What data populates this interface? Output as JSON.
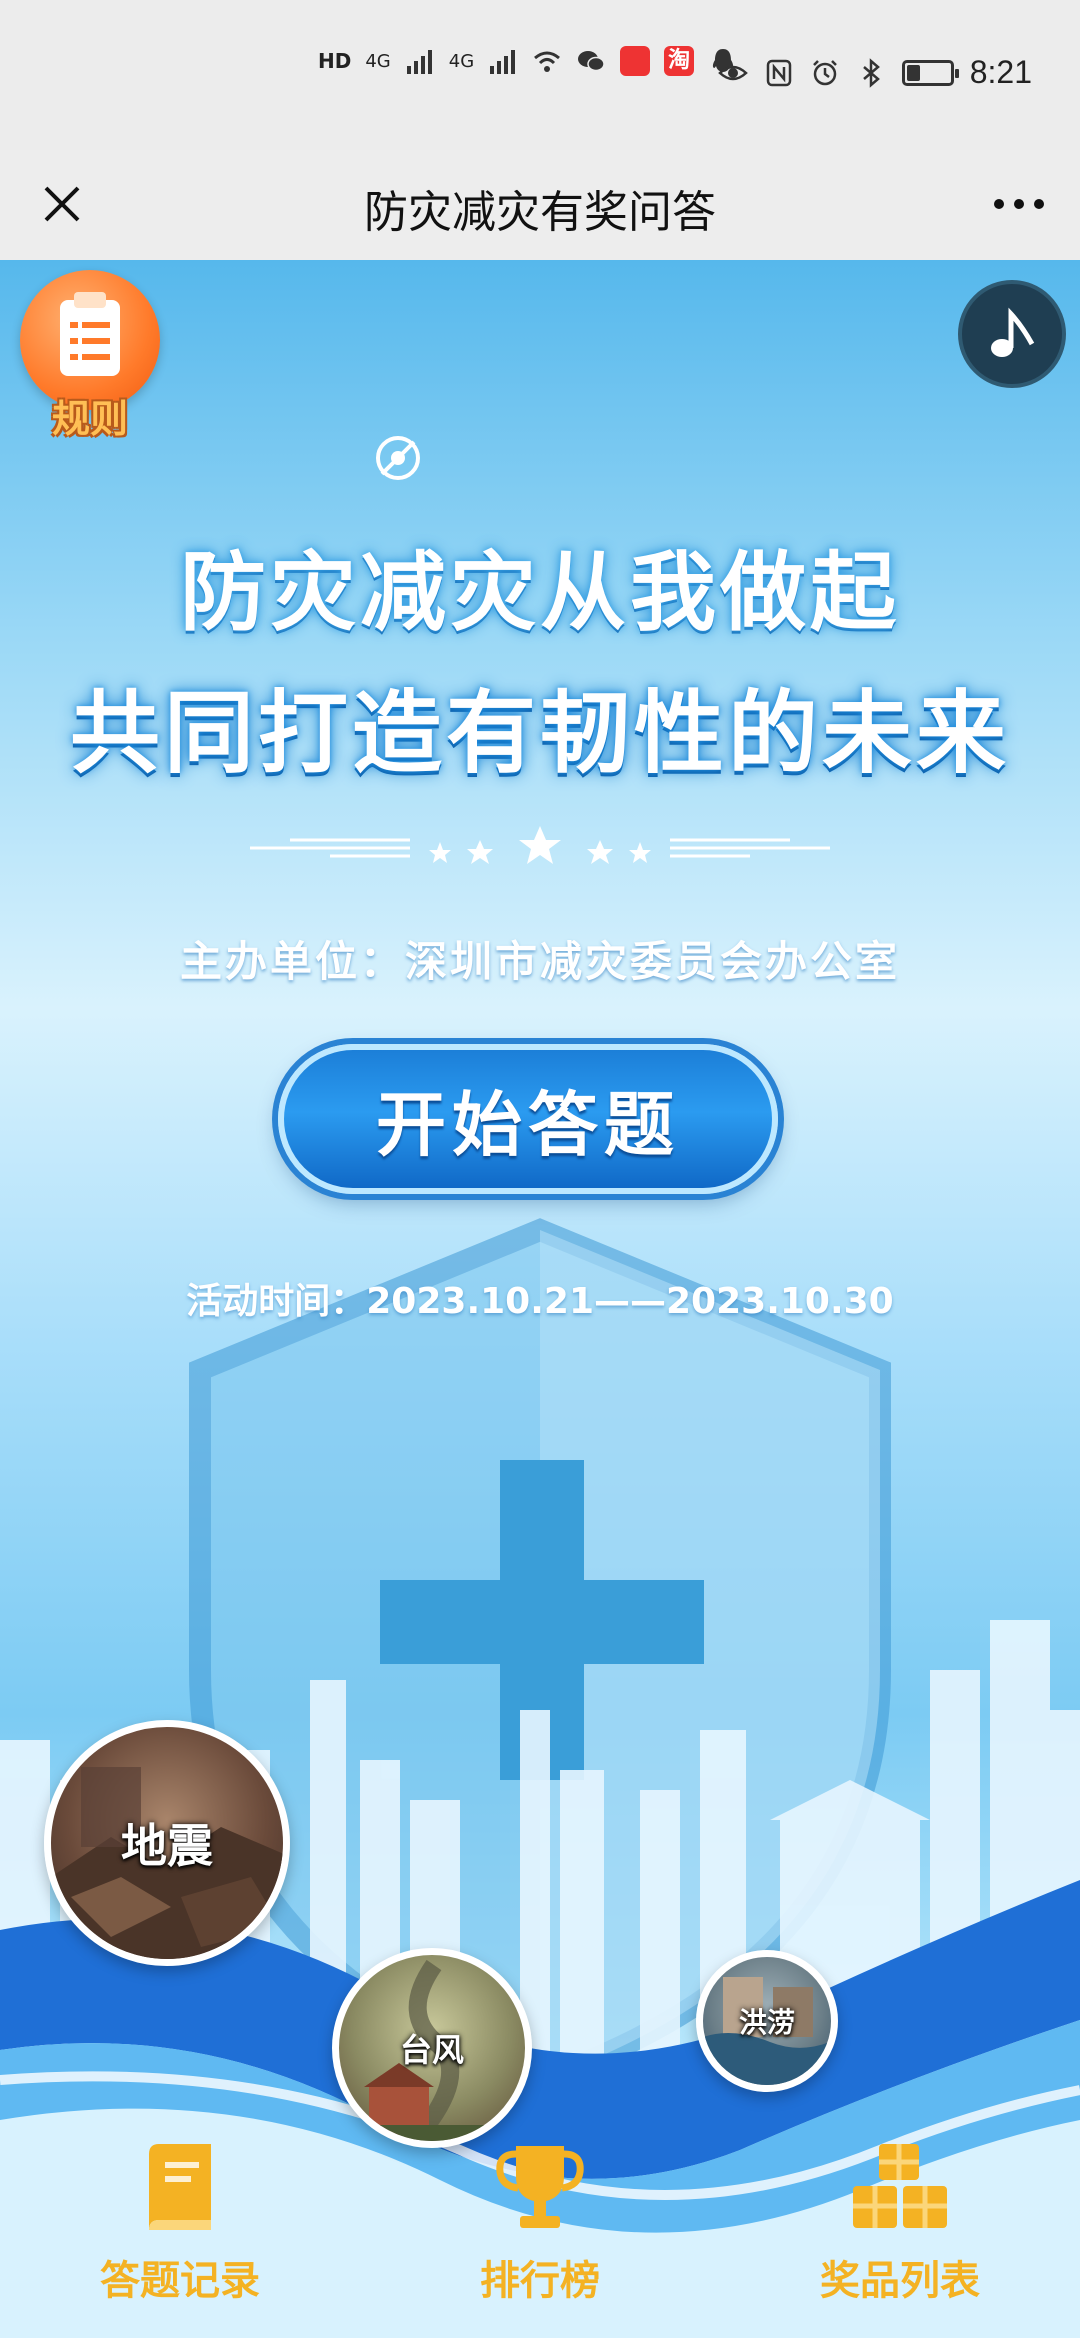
{
  "status_bar": {
    "time": "8:21",
    "network_left": "HD",
    "signal_1": "4G",
    "signal_2": "4G",
    "app_badge_taobao": "淘",
    "battery_level": 0.3
  },
  "nav": {
    "title": "防灾减灾有奖问答"
  },
  "page": {
    "rules_label": "规则",
    "headline_1": "防灾减灾从我做起",
    "headline_2": "共同打造有韧性的未来",
    "organizer": "主办单位：深圳市减灾委员会办公室",
    "start_button": "开始答题",
    "activity_time": "活动时间：2023.10.21——2023.10.30"
  },
  "disasters": [
    {
      "label": "地震"
    },
    {
      "label": "台风"
    },
    {
      "label": "洪涝"
    }
  ],
  "bottom_nav": {
    "items": [
      {
        "label": "答题记录",
        "icon": "book-icon"
      },
      {
        "label": "排行榜",
        "icon": "trophy-icon"
      },
      {
        "label": "奖品列表",
        "icon": "gift-boxes-icon"
      }
    ]
  },
  "colors": {
    "accent_blue": "#2b9bf0",
    "rules_orange": "#ff7a2a",
    "nav_gold": "#f4b223"
  }
}
